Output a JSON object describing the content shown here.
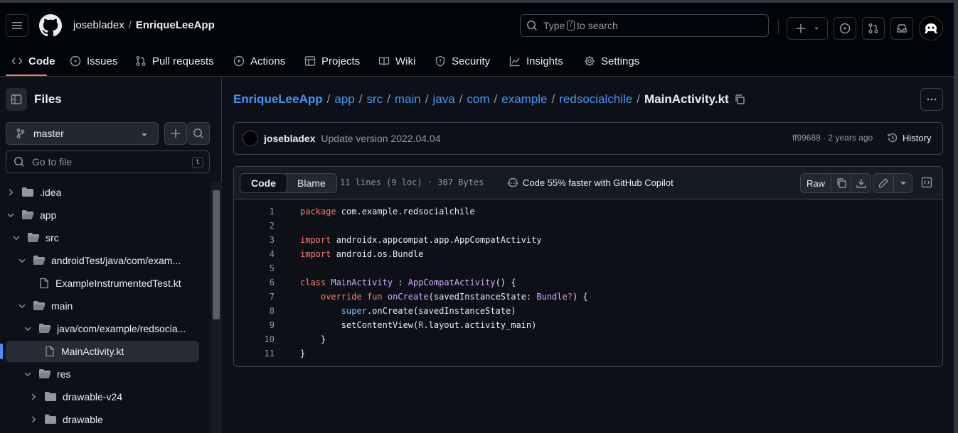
{
  "header": {
    "owner": "josebladex",
    "separator": "/",
    "repo": "EnriqueLeeApp",
    "search": {
      "before": "Type",
      "key": "/",
      "after": "to search"
    }
  },
  "nav": {
    "tabs": [
      {
        "label": "Code",
        "icon": "code-icon"
      },
      {
        "label": "Issues",
        "icon": "issue-icon"
      },
      {
        "label": "Pull requests",
        "icon": "pull-request-icon"
      },
      {
        "label": "Actions",
        "icon": "play-icon"
      },
      {
        "label": "Projects",
        "icon": "table-icon"
      },
      {
        "label": "Wiki",
        "icon": "book-icon"
      },
      {
        "label": "Security",
        "icon": "shield-icon"
      },
      {
        "label": "Insights",
        "icon": "graph-icon"
      },
      {
        "label": "Settings",
        "icon": "gear-icon"
      }
    ]
  },
  "sidebar": {
    "title": "Files",
    "branch": "master",
    "goto_placeholder": "Go to file",
    "goto_key": "t",
    "tree": [
      {
        "label": ".idea",
        "type": "folder"
      },
      {
        "label": "app",
        "type": "folder"
      },
      {
        "label": "src",
        "type": "folder"
      },
      {
        "label": "androidTest/java/com/exam...",
        "type": "folder"
      },
      {
        "label": "ExampleInstrumentedTest.kt",
        "type": "file"
      },
      {
        "label": "main",
        "type": "folder"
      },
      {
        "label": "java/com/example/redsocia...",
        "type": "folder"
      },
      {
        "label": "MainActivity.kt",
        "type": "file"
      },
      {
        "label": "res",
        "type": "folder"
      },
      {
        "label": "drawable-v24",
        "type": "folder"
      },
      {
        "label": "drawable",
        "type": "folder"
      }
    ]
  },
  "breadcrumb": {
    "parts": [
      "EnriqueLeeApp",
      "app",
      "src",
      "main",
      "java",
      "com",
      "example",
      "redsocialchile"
    ],
    "separator": "/",
    "current": "MainActivity.kt"
  },
  "commit": {
    "author": "josebladex",
    "message": "Update version 2022.04.04",
    "meta": "ff99688 · 2 years ago",
    "history_label": "History"
  },
  "code": {
    "tab_code": "Code",
    "tab_blame": "Blame",
    "file_info": "11 lines (9 loc) · 307 Bytes",
    "copilot": "Code 55% faster with GitHub Copilot",
    "raw_label": "Raw",
    "line_numbers": [
      "1",
      "2",
      "3",
      "4",
      "5",
      "6",
      "7",
      "8",
      "9",
      "10",
      "11"
    ]
  },
  "colors": {
    "background": "#0d1117",
    "accent_link": "#4493f8",
    "tab_underline": "#f78166",
    "keyword": "#ff7b72",
    "type": "#d2a8ff"
  }
}
